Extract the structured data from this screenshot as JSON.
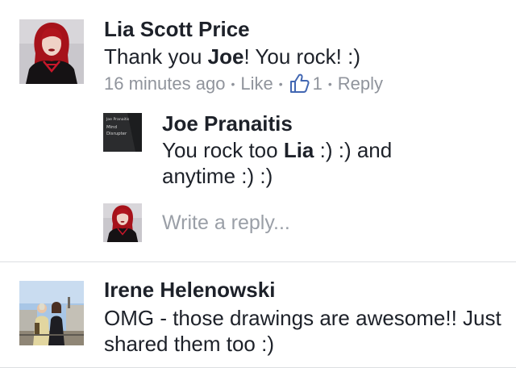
{
  "comment1": {
    "author": "Lia Scott Price",
    "text_before": "Thank you ",
    "text_bold": "Joe",
    "text_after": "! You rock! :)",
    "time": "16 minutes ago",
    "like_label": "Like",
    "like_count": "1",
    "reply_label": "Reply"
  },
  "reply1": {
    "author": "Joe Pranaitis",
    "text_before": "You rock too ",
    "text_bold": "Lia",
    "text_after": " :) :) and anytime :) :)",
    "avatar_text": [
      "Joe Pranaitis",
      "Mind",
      "Disrupter"
    ]
  },
  "reply_box": {
    "placeholder": "Write a reply..."
  },
  "comment2": {
    "author": "Irene Helenowski",
    "text": "OMG - those drawings are awesome!! Just shared them too :)"
  },
  "colors": {
    "text": "#1d2129",
    "meta": "#90949c",
    "link_blue": "#4267b2",
    "divider": "#dddfe2"
  }
}
